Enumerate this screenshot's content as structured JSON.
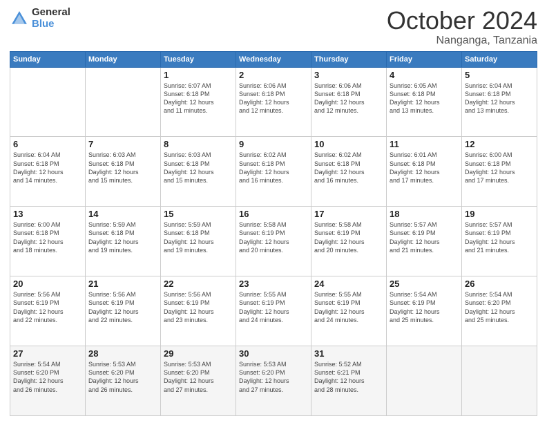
{
  "logo": {
    "general": "General",
    "blue": "Blue"
  },
  "header": {
    "month": "October 2024",
    "location": "Nanganga, Tanzania"
  },
  "weekdays": [
    "Sunday",
    "Monday",
    "Tuesday",
    "Wednesday",
    "Thursday",
    "Friday",
    "Saturday"
  ],
  "weeks": [
    [
      {
        "day": "",
        "detail": ""
      },
      {
        "day": "",
        "detail": ""
      },
      {
        "day": "1",
        "detail": "Sunrise: 6:07 AM\nSunset: 6:18 PM\nDaylight: 12 hours\nand 11 minutes."
      },
      {
        "day": "2",
        "detail": "Sunrise: 6:06 AM\nSunset: 6:18 PM\nDaylight: 12 hours\nand 12 minutes."
      },
      {
        "day": "3",
        "detail": "Sunrise: 6:06 AM\nSunset: 6:18 PM\nDaylight: 12 hours\nand 12 minutes."
      },
      {
        "day": "4",
        "detail": "Sunrise: 6:05 AM\nSunset: 6:18 PM\nDaylight: 12 hours\nand 13 minutes."
      },
      {
        "day": "5",
        "detail": "Sunrise: 6:04 AM\nSunset: 6:18 PM\nDaylight: 12 hours\nand 13 minutes."
      }
    ],
    [
      {
        "day": "6",
        "detail": "Sunrise: 6:04 AM\nSunset: 6:18 PM\nDaylight: 12 hours\nand 14 minutes."
      },
      {
        "day": "7",
        "detail": "Sunrise: 6:03 AM\nSunset: 6:18 PM\nDaylight: 12 hours\nand 15 minutes."
      },
      {
        "day": "8",
        "detail": "Sunrise: 6:03 AM\nSunset: 6:18 PM\nDaylight: 12 hours\nand 15 minutes."
      },
      {
        "day": "9",
        "detail": "Sunrise: 6:02 AM\nSunset: 6:18 PM\nDaylight: 12 hours\nand 16 minutes."
      },
      {
        "day": "10",
        "detail": "Sunrise: 6:02 AM\nSunset: 6:18 PM\nDaylight: 12 hours\nand 16 minutes."
      },
      {
        "day": "11",
        "detail": "Sunrise: 6:01 AM\nSunset: 6:18 PM\nDaylight: 12 hours\nand 17 minutes."
      },
      {
        "day": "12",
        "detail": "Sunrise: 6:00 AM\nSunset: 6:18 PM\nDaylight: 12 hours\nand 17 minutes."
      }
    ],
    [
      {
        "day": "13",
        "detail": "Sunrise: 6:00 AM\nSunset: 6:18 PM\nDaylight: 12 hours\nand 18 minutes."
      },
      {
        "day": "14",
        "detail": "Sunrise: 5:59 AM\nSunset: 6:18 PM\nDaylight: 12 hours\nand 19 minutes."
      },
      {
        "day": "15",
        "detail": "Sunrise: 5:59 AM\nSunset: 6:18 PM\nDaylight: 12 hours\nand 19 minutes."
      },
      {
        "day": "16",
        "detail": "Sunrise: 5:58 AM\nSunset: 6:19 PM\nDaylight: 12 hours\nand 20 minutes."
      },
      {
        "day": "17",
        "detail": "Sunrise: 5:58 AM\nSunset: 6:19 PM\nDaylight: 12 hours\nand 20 minutes."
      },
      {
        "day": "18",
        "detail": "Sunrise: 5:57 AM\nSunset: 6:19 PM\nDaylight: 12 hours\nand 21 minutes."
      },
      {
        "day": "19",
        "detail": "Sunrise: 5:57 AM\nSunset: 6:19 PM\nDaylight: 12 hours\nand 21 minutes."
      }
    ],
    [
      {
        "day": "20",
        "detail": "Sunrise: 5:56 AM\nSunset: 6:19 PM\nDaylight: 12 hours\nand 22 minutes."
      },
      {
        "day": "21",
        "detail": "Sunrise: 5:56 AM\nSunset: 6:19 PM\nDaylight: 12 hours\nand 22 minutes."
      },
      {
        "day": "22",
        "detail": "Sunrise: 5:56 AM\nSunset: 6:19 PM\nDaylight: 12 hours\nand 23 minutes."
      },
      {
        "day": "23",
        "detail": "Sunrise: 5:55 AM\nSunset: 6:19 PM\nDaylight: 12 hours\nand 24 minutes."
      },
      {
        "day": "24",
        "detail": "Sunrise: 5:55 AM\nSunset: 6:19 PM\nDaylight: 12 hours\nand 24 minutes."
      },
      {
        "day": "25",
        "detail": "Sunrise: 5:54 AM\nSunset: 6:19 PM\nDaylight: 12 hours\nand 25 minutes."
      },
      {
        "day": "26",
        "detail": "Sunrise: 5:54 AM\nSunset: 6:20 PM\nDaylight: 12 hours\nand 25 minutes."
      }
    ],
    [
      {
        "day": "27",
        "detail": "Sunrise: 5:54 AM\nSunset: 6:20 PM\nDaylight: 12 hours\nand 26 minutes."
      },
      {
        "day": "28",
        "detail": "Sunrise: 5:53 AM\nSunset: 6:20 PM\nDaylight: 12 hours\nand 26 minutes."
      },
      {
        "day": "29",
        "detail": "Sunrise: 5:53 AM\nSunset: 6:20 PM\nDaylight: 12 hours\nand 27 minutes."
      },
      {
        "day": "30",
        "detail": "Sunrise: 5:53 AM\nSunset: 6:20 PM\nDaylight: 12 hours\nand 27 minutes."
      },
      {
        "day": "31",
        "detail": "Sunrise: 5:52 AM\nSunset: 6:21 PM\nDaylight: 12 hours\nand 28 minutes."
      },
      {
        "day": "",
        "detail": ""
      },
      {
        "day": "",
        "detail": ""
      }
    ]
  ]
}
